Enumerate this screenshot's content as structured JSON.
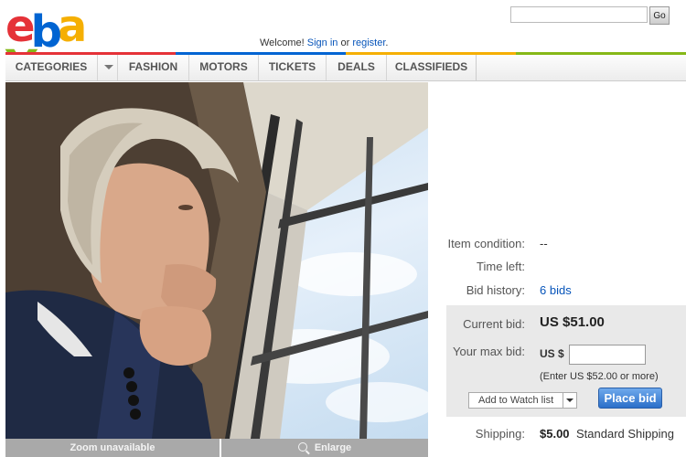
{
  "logo": {
    "letters": [
      "e",
      "b",
      "a",
      "Y"
    ],
    "registered": "®",
    "colors": [
      "#e53238",
      "#0064d2",
      "#f5af02",
      "#86b817"
    ]
  },
  "search": {
    "value": "",
    "button_label": "Go"
  },
  "welcome": {
    "prefix": "Welcome!",
    "sign_in": "Sign in",
    "or": "or",
    "register": "register",
    "suffix": "."
  },
  "nav": {
    "items": [
      "CATEGORIES",
      "FASHION",
      "MOTORS",
      "TICKETS",
      "DEALS",
      "CLASSIFIEDS"
    ]
  },
  "photo": {
    "zoom_label": "Zoom unavailable",
    "enlarge_label": "Enlarge",
    "icons": {
      "enlarge": "magnifier-icon"
    }
  },
  "details": {
    "condition_label": "Item condition:",
    "condition_value": "--",
    "time_left_label": "Time left:",
    "bid_history_label": "Bid history:",
    "bid_history_value": "6 bids"
  },
  "bid": {
    "current_label": "Current bid:",
    "current_value": "US $51.00",
    "max_label": "Your max bid:",
    "currency": "US $",
    "input_value": "",
    "hint": "(Enter US $52.00 or more)",
    "watch_label": "Add to Watch list",
    "place_label": "Place bid"
  },
  "shipping": {
    "label": "Shipping:",
    "cost": "$5.00",
    "type": "Standard Shipping"
  },
  "colors": {
    "accent_blue": "#0654ba",
    "bid_box": "#e9e9e9"
  }
}
